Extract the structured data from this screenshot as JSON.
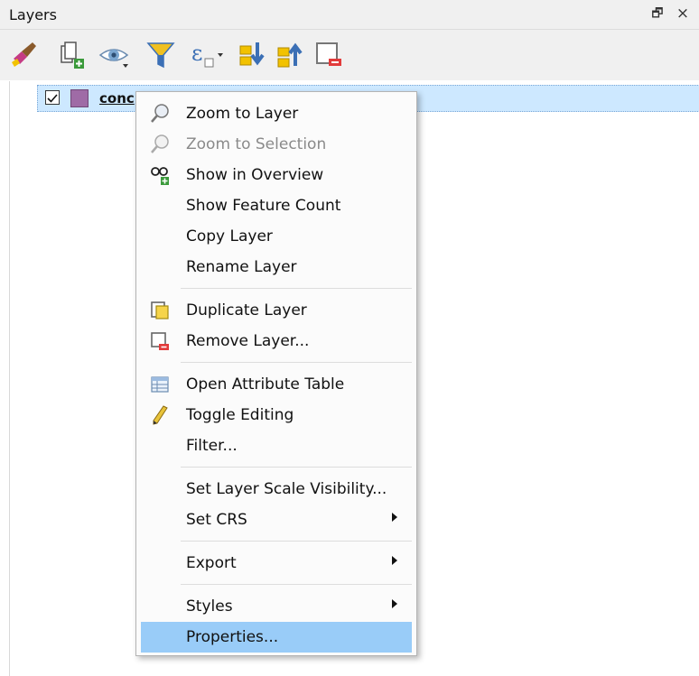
{
  "panel": {
    "title": "Layers",
    "float_glyph": "🗗",
    "close_glyph": "×"
  },
  "toolbar": {
    "icons": [
      "style-brush-icon",
      "add-group-icon",
      "manage-visibility-icon",
      "filter-legend-icon",
      "filter-expression-icon",
      "expand-all-icon",
      "collapse-all-icon",
      "remove-layer-icon"
    ]
  },
  "layer": {
    "name": "conc",
    "checked": true,
    "color": "#9f6ba6"
  },
  "menu": {
    "items": [
      {
        "label": "Zoom to Layer",
        "icon": "zoom-layer-icon"
      },
      {
        "label": "Zoom to Selection",
        "icon": "zoom-selection-icon",
        "disabled": true
      },
      {
        "label": "Show in Overview",
        "icon": "overview-icon"
      },
      {
        "label": "Show Feature Count"
      },
      {
        "label": "Copy Layer"
      },
      {
        "label": "Rename Layer"
      },
      {
        "label": "Duplicate Layer",
        "icon": "duplicate-layer-icon"
      },
      {
        "label": "Remove Layer...",
        "icon": "remove-layer-icon"
      },
      {
        "label": "Open Attribute Table",
        "icon": "attribute-table-icon"
      },
      {
        "label": "Toggle Editing",
        "icon": "pencil-icon"
      },
      {
        "label": "Filter..."
      },
      {
        "label": "Set Layer Scale Visibility..."
      },
      {
        "label": "Set CRS",
        "submenu": true
      },
      {
        "label": "Export",
        "submenu": true
      },
      {
        "label": "Styles",
        "submenu": true
      },
      {
        "label": "Properties...",
        "selected": true
      }
    ]
  },
  "colors": {
    "selection": "#99ccf8",
    "row_highlight": "#cde8ff",
    "disabled_text": "#8a8a8a"
  }
}
